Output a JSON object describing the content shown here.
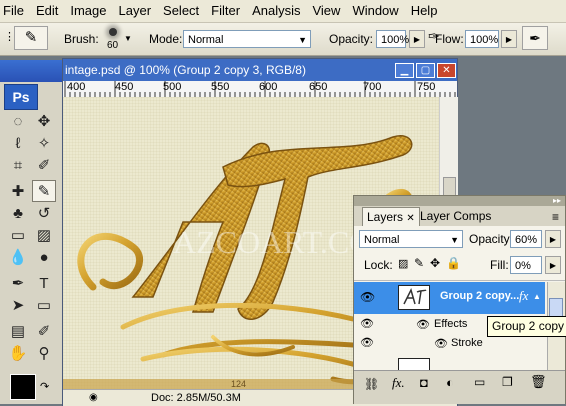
{
  "menu": [
    "File",
    "Edit",
    "Image",
    "Layer",
    "Select",
    "Filter",
    "Analysis",
    "View",
    "Window",
    "Help"
  ],
  "options": {
    "brush_label": "Brush:",
    "brush_size": "60",
    "mode_label": "Mode:",
    "mode_value": "Normal",
    "opacity_label": "Opacity:",
    "opacity_value": "100%",
    "flow_label": "Flow:",
    "flow_value": "100%"
  },
  "toolbox": {
    "logo": "Ps"
  },
  "document": {
    "title": "intage.psd @ 100% (Group 2 copy 3, RGB/8)",
    "ruler_labels": [
      "400",
      "450",
      "500",
      "550",
      "600",
      "650",
      "700",
      "750"
    ],
    "watermark": "AZCOART.COM",
    "status": "Doc: 2.85M/50.3M",
    "frame_number": "124"
  },
  "layers_panel": {
    "tabs": [
      "Layers",
      "Layer Comps"
    ],
    "blend_mode": "Normal",
    "opacity_label": "Opacity:",
    "opacity_value": "60%",
    "lock_label": "Lock:",
    "fill_label": "Fill:",
    "fill_value": "0%",
    "layer_name": "Group 2 copy...",
    "effects_label": "Effects",
    "stroke_label": "Stroke",
    "tooltip": "Group 2 copy 3",
    "fx_badge": "fx"
  },
  "colors": {
    "title_bar": "#3d6cc4",
    "selected_layer": "#3c8ee8",
    "gold": "#d4a22e",
    "canvas_bg": "#ece9cf"
  }
}
